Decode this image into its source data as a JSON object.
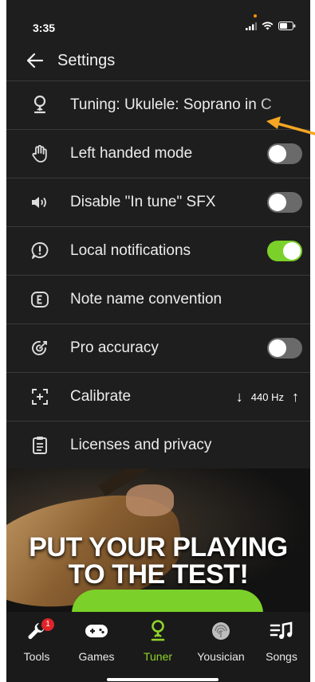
{
  "status_bar": {
    "time": "3:35"
  },
  "header": {
    "title": "Settings"
  },
  "settings": [
    {
      "label": "Tuning: Ukulele: Soprano in C",
      "icon": "tuner-icon"
    },
    {
      "label": "Left handed mode",
      "icon": "hand-icon",
      "toggle": "off"
    },
    {
      "label": "Disable \"In tune\" SFX",
      "icon": "speaker-icon",
      "toggle": "off"
    },
    {
      "label": "Local notifications",
      "icon": "alert-icon",
      "toggle": "on"
    },
    {
      "label": "Note name convention",
      "icon": "note-name-icon"
    },
    {
      "label": "Pro accuracy",
      "icon": "target-icon",
      "toggle": "off"
    },
    {
      "label": "Calibrate",
      "icon": "calibrate-icon",
      "value": "440 Hz"
    },
    {
      "label": "Licenses and privacy",
      "icon": "document-icon"
    }
  ],
  "ad": {
    "line1": "PUT YOUR PLAYING",
    "line2": "TO THE TEST!"
  },
  "tabs": [
    {
      "label": "Tools",
      "icon": "wrench-icon",
      "badge": "1"
    },
    {
      "label": "Games",
      "icon": "gamepad-icon"
    },
    {
      "label": "Tuner",
      "icon": "tuner-icon",
      "active": true
    },
    {
      "label": "Yousician",
      "icon": "fingerprint-icon"
    },
    {
      "label": "Songs",
      "icon": "songs-icon"
    }
  ],
  "colors": {
    "accent": "#7bd12a",
    "annotation": "#f5a623",
    "badge": "#e0242a"
  }
}
